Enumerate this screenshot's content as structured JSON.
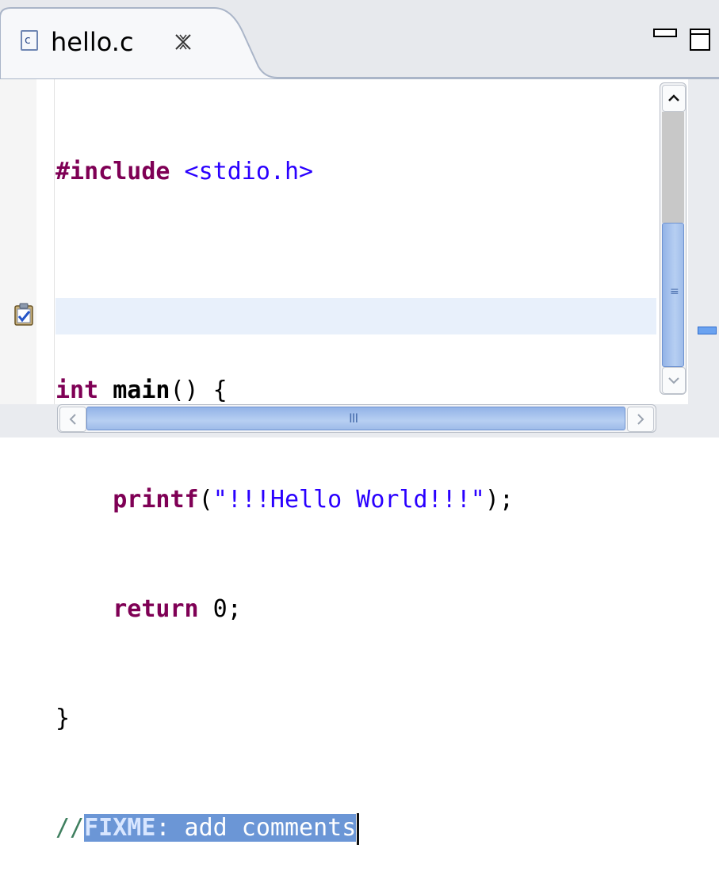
{
  "tab": {
    "title": "hello.c",
    "file_icon_letter": "c",
    "close_icon": "close-icon"
  },
  "window_controls": {
    "minimize_icon": "minimize-icon",
    "maximize_icon": "maximize-icon"
  },
  "code_lines": [
    {
      "directive": "#include",
      "header": " <stdio.h>"
    },
    {
      "blank": ""
    },
    {
      "type": "int",
      "name": " main",
      "rest": "() {"
    },
    {
      "indent": "    ",
      "fn": "printf",
      "open": "(",
      "string": "\"!!!Hello World!!!\"",
      "close": ");"
    },
    {
      "indent": "    ",
      "keyword": "return",
      "value": " 0;"
    },
    {
      "brace": "}"
    },
    {
      "comment_prefix": "//",
      "task_tag": "FIXME",
      "comment_text": ": add comments"
    }
  ],
  "gutter": {
    "task_marker_icon": "task-marker-icon"
  },
  "colors": {
    "keyword": "#7f0055",
    "string": "#2a00ff",
    "comment": "#3f7f5f",
    "selection": "#6b96d6",
    "scroll_thumb": "#93b3e7"
  },
  "scrollbars": {
    "vertical_grip": "≡",
    "horizontal_grip": "III"
  }
}
